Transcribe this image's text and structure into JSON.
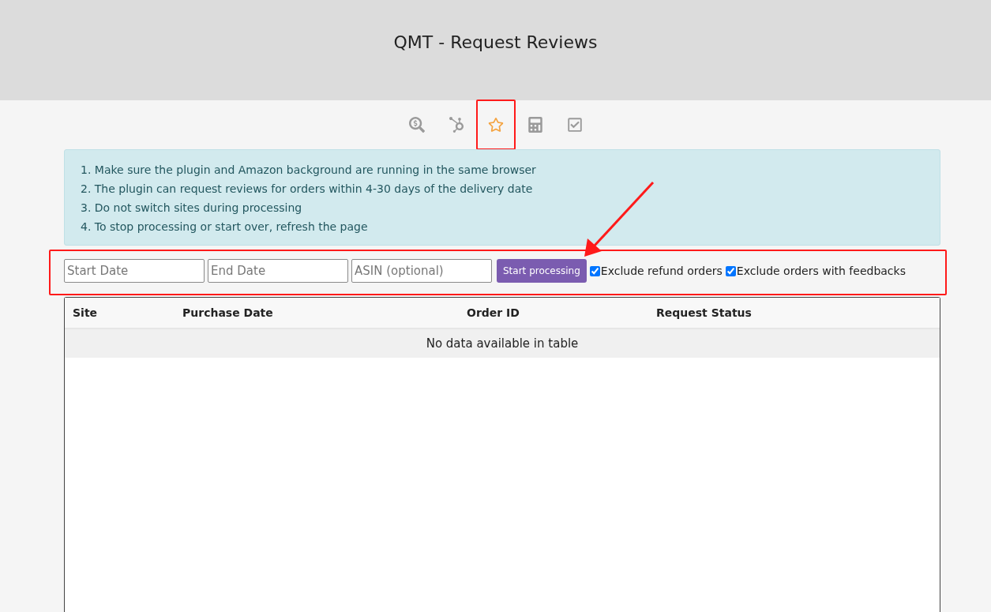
{
  "header": {
    "title": "QMT - Request Reviews"
  },
  "tabs": [
    {
      "selected": false,
      "highlighted": false
    },
    {
      "selected": false,
      "highlighted": false
    },
    {
      "selected": true,
      "highlighted": true
    },
    {
      "selected": false,
      "highlighted": false
    },
    {
      "selected": false,
      "highlighted": false
    }
  ],
  "notice": [
    "1. Make sure the plugin and Amazon background are running in the same browser",
    "2. The plugin can request reviews for orders within 4-30 days of the delivery date",
    "3. Do not switch sites during processing",
    "4. To stop processing or start over, refresh the page"
  ],
  "filters": {
    "highlighted": true,
    "pointer_arrow": true,
    "fields": [
      {
        "placeholder": "Start Date"
      },
      {
        "placeholder": "End Date"
      },
      {
        "placeholder": "ASIN (optional)"
      }
    ],
    "button": "Start processing",
    "checkboxes": [
      {
        "label": "Exclude refund orders",
        "checked": true
      },
      {
        "label": "Exclude orders with feedbacks",
        "checked": true
      }
    ]
  },
  "table": {
    "columns": [
      "Site",
      "Purchase Date",
      "Order ID",
      "Request Status"
    ],
    "empty_message": "No data available in table"
  }
}
